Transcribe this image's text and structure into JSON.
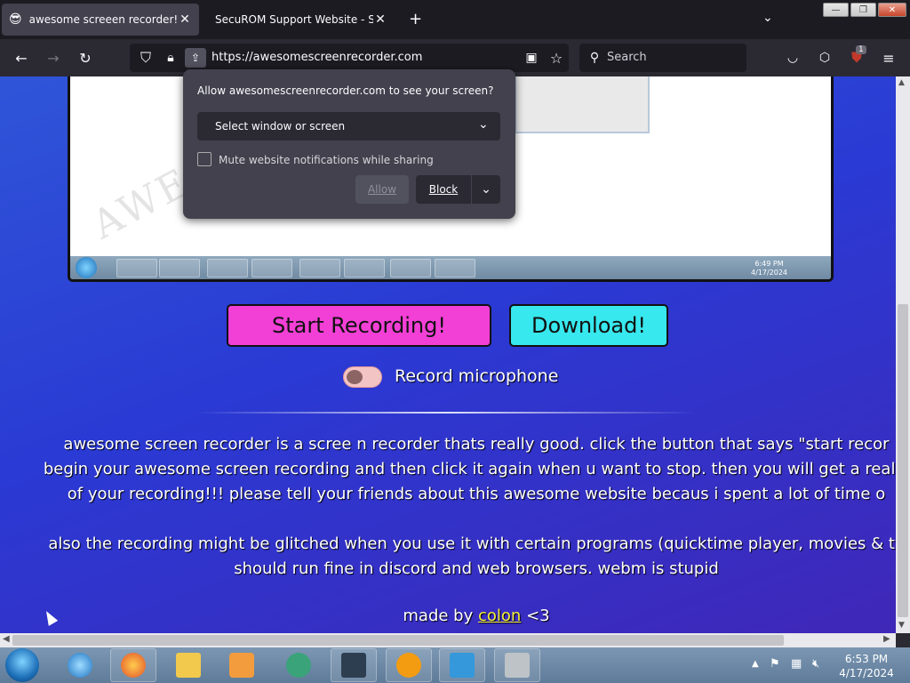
{
  "tabs": [
    {
      "title": "awesome screeen recorder!! !",
      "active": true
    },
    {
      "title": "SecuROM Support Website - SecuR",
      "active": false
    }
  ],
  "navbar": {
    "url": "https://awesomescreenrecorder.com",
    "search_placeholder": "Search",
    "extension_badge": "1"
  },
  "popup": {
    "prompt": "Allow awesomescreenrecorder.com to see your screen?",
    "select_value": "Select window or screen",
    "mute_label": "Mute website notifications while sharing",
    "allow_label": "Allow",
    "block_label": "Block"
  },
  "preview": {
    "watermark": "AWES",
    "time": "6:49 PM",
    "date": "4/17/2024"
  },
  "page": {
    "start_button": "Start Recording!",
    "download_button": "Download!",
    "mic_label": "Record microphone",
    "para1_line1": "awesome screen recorder is a scree n recorder thats really good. click the button that says \"start recor",
    "para1_line2": "begin your awesome screen recording and then click it again when u want to stop. then you will get a really",
    "para1_line3": "of your recording!!! please tell your friends about this awesome website becaus i spent a lot of time o",
    "para2_line1": "also the recording might be glitched when you use it with certain programs (quicktime player, movies & tv",
    "para2_line2": "should run fine in discord and web browsers. webm is stupid",
    "madeby_prefix": "made by",
    "madeby_link": "colon",
    "madeby_suffix": "<3"
  },
  "taskbar": {
    "time": "6:53 PM",
    "date": "4/17/2024"
  },
  "colors": {
    "start_button": "#f23fd6",
    "download_button": "#37e8ee",
    "link": "#f5f03a"
  }
}
